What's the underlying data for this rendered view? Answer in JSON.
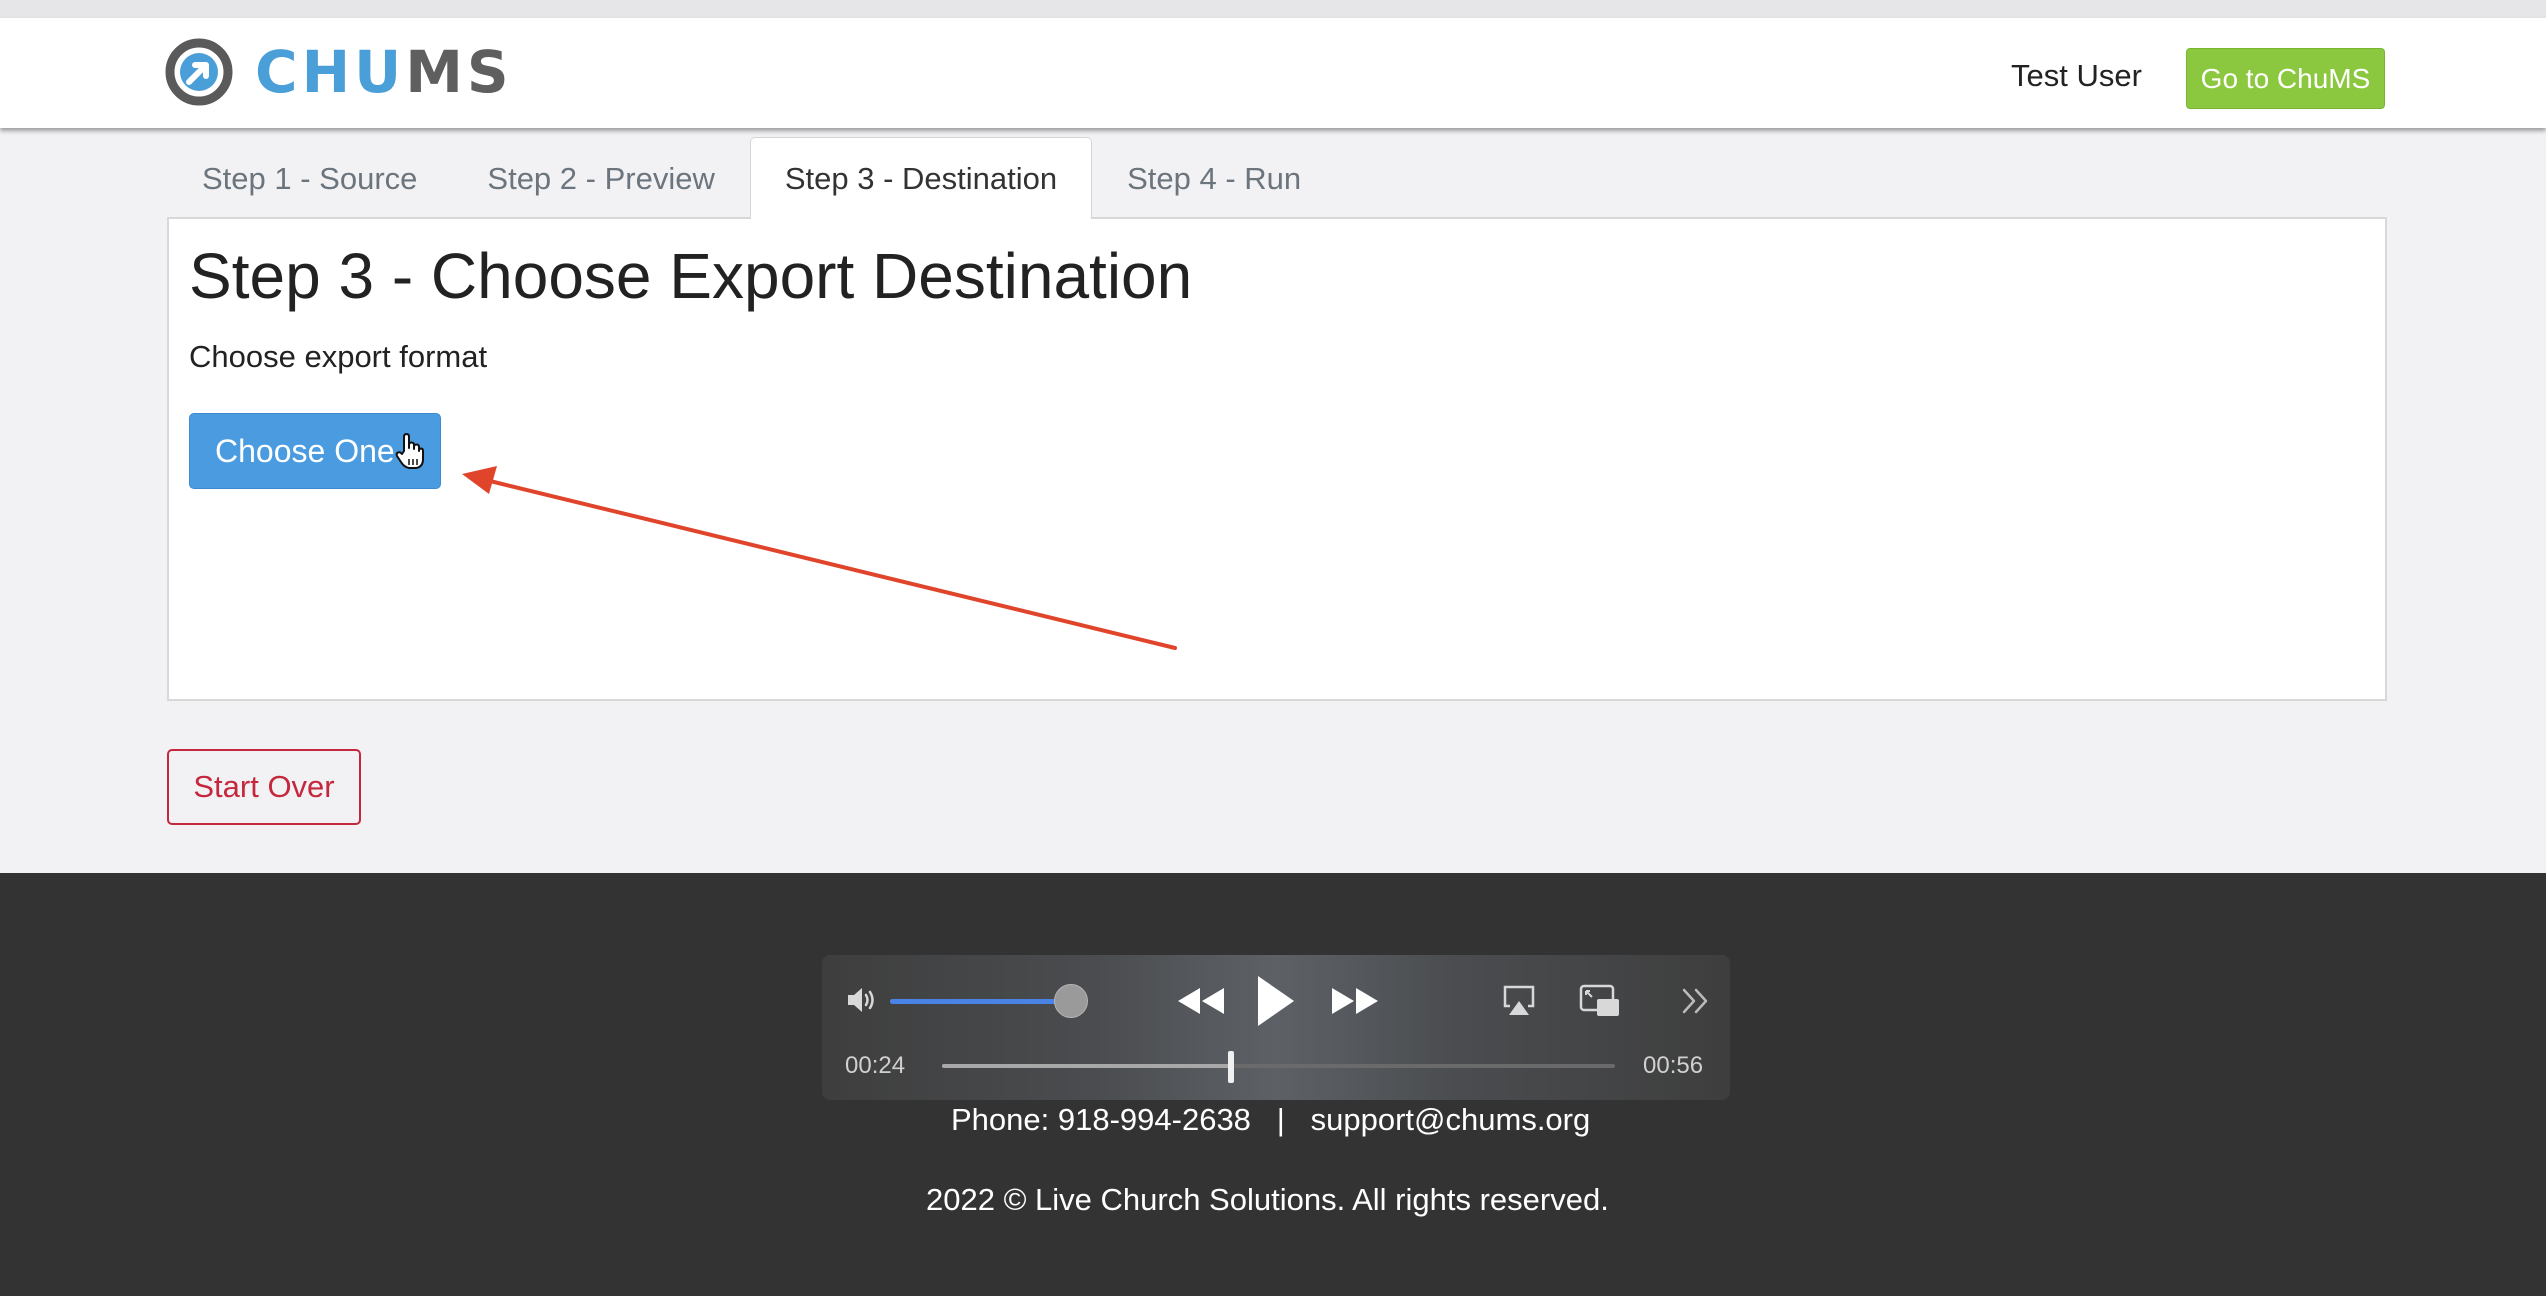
{
  "header": {
    "logo": {
      "part1": "CHU",
      "part2": "MS"
    },
    "user_name": "Test User",
    "go_button": "Go to ChuMS"
  },
  "tabs": [
    {
      "label": "Step 1 - Source",
      "active": false
    },
    {
      "label": "Step 2 - Preview",
      "active": false
    },
    {
      "label": "Step 3 - Destination",
      "active": true
    },
    {
      "label": "Step 4 - Run",
      "active": false
    }
  ],
  "main": {
    "title": "Step 3 - Choose Export Destination",
    "format_label": "Choose export format",
    "choose_button": "Choose One",
    "start_over_button": "Start Over"
  },
  "player": {
    "current_time": "00:24",
    "duration": "00:56",
    "progress": 0.43,
    "volume": 1.0
  },
  "footer": {
    "contact": "Phone: 918-994-2638   |   support@chums.org",
    "copyright": "2022 © Live Church Solutions. All rights reserved."
  },
  "colors": {
    "accent_blue": "#4a9be0",
    "chums_green": "#8bc83f",
    "danger_red": "#c5283d",
    "annotation_arrow": "#e0452c",
    "footer_bg": "#333333"
  }
}
